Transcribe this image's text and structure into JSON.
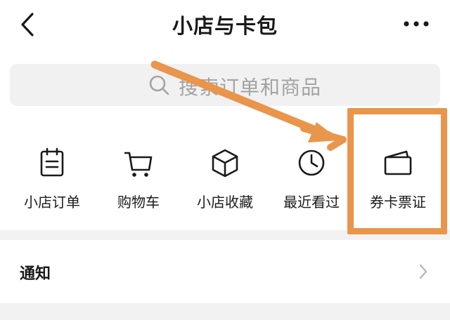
{
  "header": {
    "title": "小店与卡包",
    "back_icon": "chevron-left-icon",
    "more_icon": "more-horizontal-icon"
  },
  "search": {
    "placeholder": "搜索订单和商品",
    "icon": "search-icon"
  },
  "actions": [
    {
      "label": "小店订单",
      "icon": "order-list-icon"
    },
    {
      "label": "购物车",
      "icon": "shopping-cart-icon"
    },
    {
      "label": "小店收藏",
      "icon": "box-icon"
    },
    {
      "label": "最近看过",
      "icon": "clock-icon"
    },
    {
      "label": "券卡票证",
      "icon": "card-wallet-icon"
    }
  ],
  "notifications": {
    "label": "通知",
    "chevron_icon": "chevron-right-icon"
  },
  "annotation": {
    "color": "#e9954b",
    "highlight_target": "券卡票证"
  },
  "colors": {
    "background": "#ffffff",
    "search_bg": "#f1f1f1",
    "divider": "#f2f2f2",
    "text": "#1a1a1a",
    "placeholder": "#a3a3a3"
  }
}
